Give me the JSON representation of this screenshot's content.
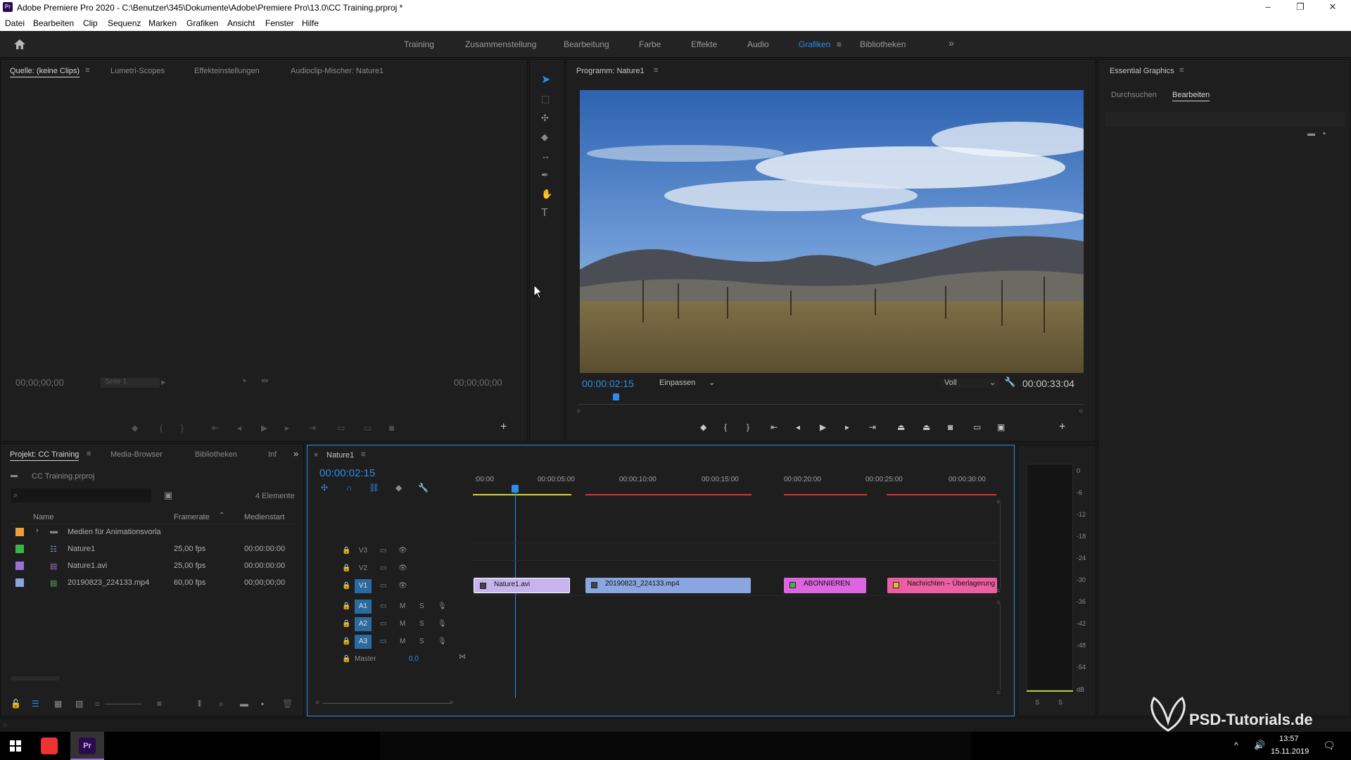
{
  "window": {
    "title": "Adobe Premiere Pro 2020 - C:\\Benutzer\\345\\Dokumente\\Adobe\\Premiere Pro\\13.0\\CC Training.prproj *",
    "app_icon": "Pr",
    "min": "–",
    "max": "❐",
    "close": "✕"
  },
  "menu": [
    "Datei",
    "Bearbeiten",
    "Clip",
    "Sequenz",
    "Marken",
    "Grafiken",
    "Ansicht",
    "Fenster",
    "Hilfe"
  ],
  "workspaces": {
    "items": [
      "Training",
      "Zusammenstellung",
      "Bearbeitung",
      "Farbe",
      "Effekte",
      "Audio",
      "Grafiken",
      "Bibliotheken"
    ],
    "active": "Grafiken",
    "more": "»"
  },
  "source_panel": {
    "tabs": [
      "Quelle: (keine Clips)",
      "Lumetri-Scopes",
      "Effekteinstellungen",
      "Audioclip-Mischer: Nature1"
    ],
    "tc_left": "00;00;00;00",
    "page": "Seite 1",
    "tc_right": "00;00;00;00"
  },
  "program_panel": {
    "tab": "Programm: Nature1",
    "timecode": "00:00:02:15",
    "fit": "Einpassen",
    "quality": "Voll",
    "duration": "00:00:33:04",
    "playhead_fraction": 0.069
  },
  "essential_graphics": {
    "tab": "Essential Graphics",
    "subtabs": [
      "Durchsuchen",
      "Bearbeiten"
    ],
    "active": "Bearbeiten"
  },
  "project_panel": {
    "tabs": [
      "Projekt: CC Training",
      "Media-Browser",
      "Bibliotheken",
      "Inf"
    ],
    "project_file": "CC Training.prproj",
    "count": "4 Elemente",
    "columns": [
      "Name",
      "Framerate",
      "Medienstart"
    ],
    "items": [
      {
        "name": "Medien für Animationsvorla",
        "fps": "",
        "start": "",
        "color": "#e8a33a",
        "icon": "folder-icon"
      },
      {
        "name": "Nature1",
        "fps": "25,00 fps",
        "start": "00:00:00:00",
        "color": "#3fb24a",
        "icon": "sequence-icon"
      },
      {
        "name": "Nature1.avi",
        "fps": "25,00 fps",
        "start": "00:00:00:00",
        "color": "#9b6fd6",
        "icon": "video-file-icon"
      },
      {
        "name": "20190823_224133.mp4",
        "fps": "60,00 fps",
        "start": "00;00;00;00",
        "color": "#8aa6e0",
        "icon": "video-file-icon"
      }
    ]
  },
  "timeline": {
    "tab": "Nature1",
    "timecode": "00:00:02:15",
    "ruler": [
      ":00:00",
      "00:00:05:00",
      "00:00:10:00",
      "00:00:15:00",
      "00:00:20:00",
      "00:00:25:00",
      "00:00:30:00"
    ],
    "video_tracks": [
      "V3",
      "V2",
      "V1"
    ],
    "audio_tracks": [
      "A1",
      "A2",
      "A3"
    ],
    "master": "Master",
    "master_value": "0,0",
    "clips": [
      {
        "label": "Nature1.avi",
        "color": "#c7b3ee"
      },
      {
        "label": "20190823_224133.mp4",
        "color": "#8aa6e0"
      },
      {
        "label": "ABONNIEREN",
        "color": "#dd66e0"
      },
      {
        "label": "Nachrichten – Überlagerung li",
        "color": "#ec5fa3"
      }
    ]
  },
  "audio_meter": {
    "scale": [
      "0",
      "-6",
      "-12",
      "-18",
      "-24",
      "-30",
      "-36",
      "-42",
      "-48",
      "-54",
      "dB"
    ],
    "solo": [
      "S",
      "S"
    ]
  },
  "taskbar": {
    "time": "13:57",
    "date": "15.11.2019",
    "watermark": "PSD-Tutorials.de"
  }
}
